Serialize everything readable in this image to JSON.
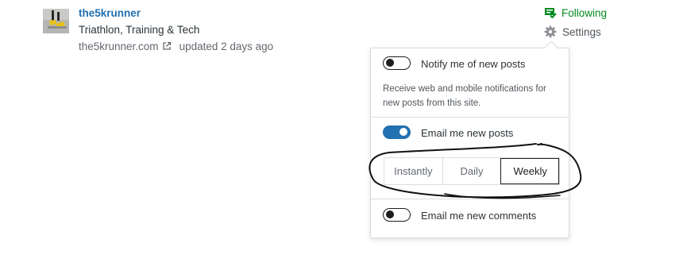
{
  "site": {
    "name": "the5krunner",
    "description": "Triathlon, Training & Tech",
    "url": "the5krunner.com",
    "updated": "updated 2 days ago"
  },
  "actions": {
    "following_label": "Following",
    "settings_label": "Settings"
  },
  "settings_popover": {
    "notify": {
      "label": "Notify me of new posts",
      "help": "Receive web and mobile notifications for new posts from this site.",
      "enabled": false
    },
    "email_posts": {
      "label": "Email me new posts",
      "enabled": true,
      "frequency_options": [
        "Instantly",
        "Daily",
        "Weekly"
      ],
      "selected": "Weekly"
    },
    "email_comments": {
      "label": "Email me new comments",
      "enabled": false
    }
  },
  "colors": {
    "link_blue": "#2271b1",
    "following_green": "#008a20",
    "toggle_on": "#2271b1",
    "annotation_ink": "#111111"
  },
  "icons": {
    "external_link": "external-link-icon",
    "following": "following-reader-icon",
    "settings": "gear-icon"
  }
}
